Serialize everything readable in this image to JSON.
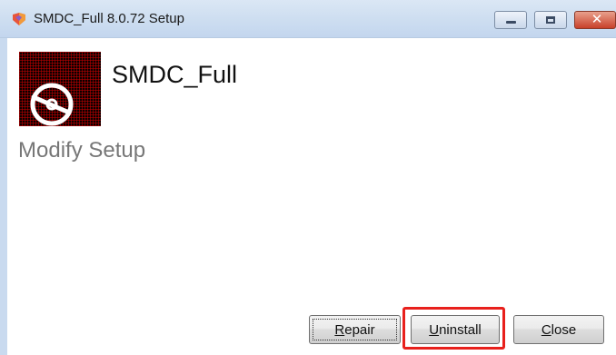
{
  "window": {
    "title": "SMDC_Full 8.0.72 Setup"
  },
  "header": {
    "product_name": "SMDC_Full",
    "subtitle": "Modify Setup"
  },
  "buttons": {
    "repair": {
      "hotkey": "R",
      "rest": "epair"
    },
    "uninstall": {
      "hotkey": "U",
      "rest": "ninstall"
    },
    "close": {
      "hotkey": "C",
      "rest": "lose"
    }
  },
  "icons": {
    "app": "installer-app-icon",
    "product": "disc-icon"
  },
  "colors": {
    "titlebar": "#cfdff1",
    "subtitle": "#777777",
    "highlight": "#e8201c",
    "close_caption": "#c8412a"
  }
}
